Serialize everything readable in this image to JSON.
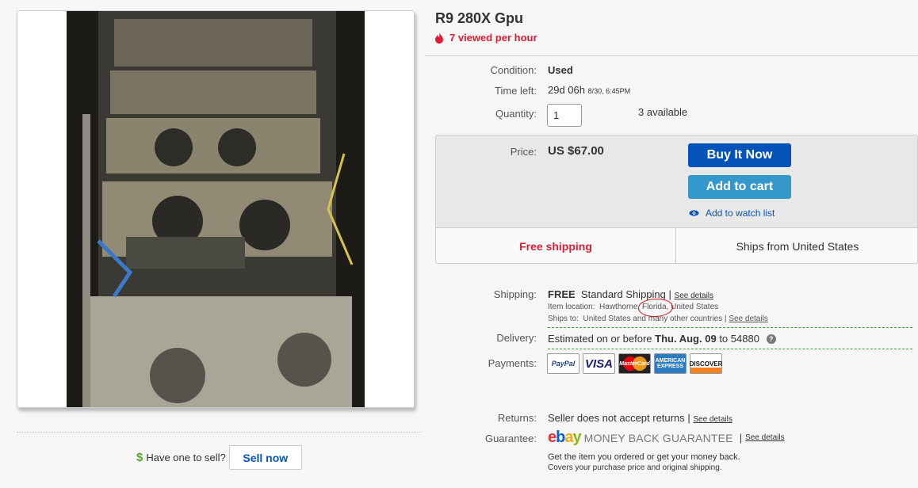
{
  "listing": {
    "title": "R9 280X Gpu",
    "views": "7 viewed per hour",
    "condition_label": "Condition:",
    "condition": "Used",
    "time_left_label": "Time left:",
    "time_left": "29d 06h",
    "time_left_end": "8/30, 6:45PM",
    "quantity_label": "Quantity:",
    "quantity_value": "1",
    "available": "3 available"
  },
  "price_box": {
    "price_label": "Price:",
    "price": "US $67.00",
    "buy_now": "Buy It Now",
    "add_to_cart": "Add to cart",
    "watch": "Add to watch list",
    "free_shipping": "Free shipping",
    "ships_from": "Ships from United States"
  },
  "shipping": {
    "label": "Shipping:",
    "free": "FREE",
    "method": "Standard Shipping",
    "sep": "|",
    "see_details": "See details",
    "location_label": "Item location:",
    "location_city": "Hawthorne,",
    "location_state": "Florida,",
    "location_country": "United States",
    "ships_to_label": "Ships to:",
    "ships_to": "United States and many other countries",
    "ships_to_details": "See details"
  },
  "delivery": {
    "label": "Delivery:",
    "estimated": "Estimated on or before",
    "date": "Thu. Aug. 09",
    "to": "to",
    "zip": "54880",
    "help": "?"
  },
  "payments": {
    "label": "Payments:",
    "paypal": "PayPal",
    "visa": "VISA",
    "mastercard": "MasterCard",
    "amex": "AMERICAN EXPRESS",
    "discover": "DISCOVER"
  },
  "returns": {
    "label": "Returns:",
    "text": "Seller does not accept returns",
    "sep": "|",
    "see_details": "See details"
  },
  "guarantee": {
    "label": "Guarantee:",
    "logo_e": "e",
    "logo_b": "b",
    "logo_a": "a",
    "logo_y": "y",
    "mbg": "MONEY BACK GUARANTEE",
    "sep": "|",
    "see_details": "See details",
    "line1": "Get the item you ordered or get your money back.",
    "line2": "Covers your purchase price and original shipping."
  },
  "sell": {
    "icon": "$",
    "prompt": "Have one to sell?",
    "button": "Sell now"
  },
  "icons": {
    "views": "flame-icon",
    "watch": "eye-icon",
    "sell": "dollar-icon",
    "delivery_help": "help-icon"
  },
  "colors": {
    "accent_red": "#dd1e31",
    "buy_blue": "#0654ba",
    "cart_blue": "#3498ca",
    "divider_green": "#3a9b3a"
  }
}
